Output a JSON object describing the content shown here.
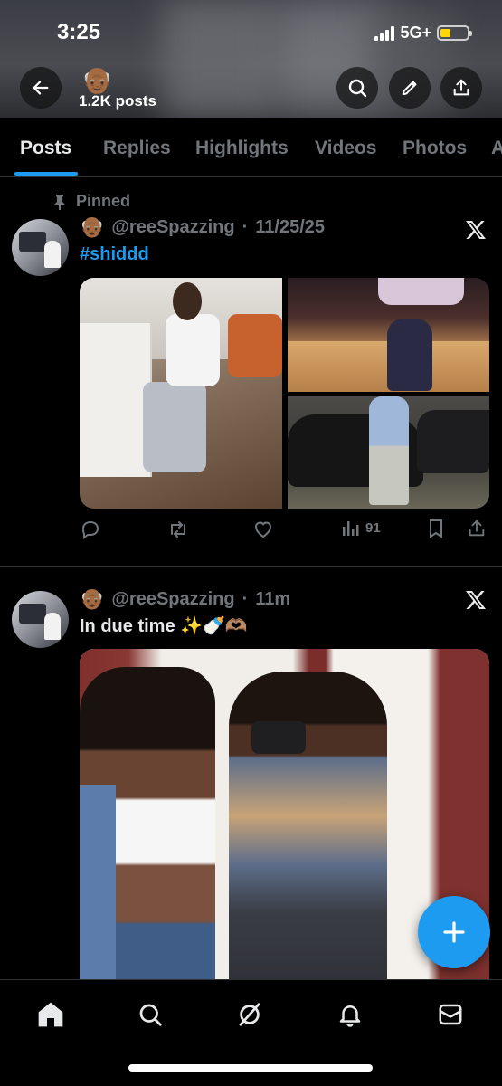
{
  "status_bar": {
    "time": "3:25",
    "network": "5G+",
    "battery_level": 0.4
  },
  "header": {
    "avatar_emoji": "👴🏾",
    "post_count": "1.2K posts"
  },
  "tabs": [
    {
      "label": "Posts",
      "active": true
    },
    {
      "label": "Replies",
      "active": false
    },
    {
      "label": "Highlights",
      "active": false
    },
    {
      "label": "Videos",
      "active": false
    },
    {
      "label": "Photos",
      "active": false
    },
    {
      "label": "A",
      "active": false
    }
  ],
  "posts": [
    {
      "pinned_label": "Pinned",
      "avatar_emoji": "👴🏾",
      "handle": "@reeSpazzing",
      "separator": "·",
      "time": "11/25/25",
      "text": "#shiddd",
      "views": "91"
    },
    {
      "avatar_emoji": "👴🏾",
      "handle": "@reeSpazzing",
      "separator": "·",
      "time": "11m",
      "text": "In due time ✨🍼🫶🏽"
    }
  ],
  "colors": {
    "accent": "#1d9bf0",
    "muted": "#71767b",
    "text": "#e7e9ea",
    "background": "#000000",
    "battery": "#ffd60a"
  },
  "icons": {
    "back": "arrow-left-icon",
    "search": "search-icon",
    "edit": "pencil-icon",
    "share": "share-icon",
    "pin": "pin-icon",
    "x_logo": "x-logo-icon",
    "reply": "reply-icon",
    "repost": "repost-icon",
    "like": "heart-icon",
    "views": "views-icon",
    "bookmark": "bookmark-icon",
    "compose": "plus-icon",
    "home": "home-icon",
    "explore": "search-icon",
    "grok": "grok-icon",
    "notifications": "bell-icon",
    "messages": "mail-icon"
  }
}
